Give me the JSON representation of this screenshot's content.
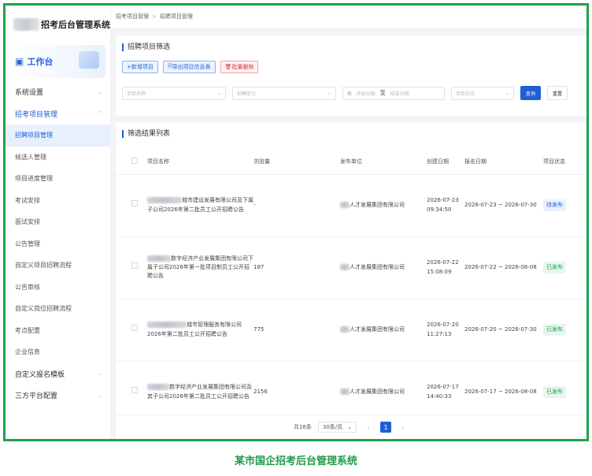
{
  "sidebar": {
    "brand_title": "招考后台管理系统",
    "workbench": "工作台",
    "menu": [
      {
        "label": "系统设置",
        "type": "group",
        "chevron": "⌄"
      },
      {
        "label": "招考项目管理",
        "type": "group-open",
        "chevron": "⌃"
      },
      {
        "label": "招聘项目管理",
        "type": "active"
      },
      {
        "label": "候选人管理",
        "type": "item"
      },
      {
        "label": "项目进度管理",
        "type": "item"
      },
      {
        "label": "考试安排",
        "type": "item"
      },
      {
        "label": "面试安排",
        "type": "item"
      },
      {
        "label": "公告管理",
        "type": "item"
      },
      {
        "label": "自定义项目招聘流程",
        "type": "item"
      },
      {
        "label": "公告审核",
        "type": "item"
      },
      {
        "label": "自定义岗位招聘流程",
        "type": "item"
      },
      {
        "label": "考点配置",
        "type": "item"
      },
      {
        "label": "企业信息",
        "type": "item"
      },
      {
        "label": "自定义报名模板",
        "type": "group",
        "chevron": "⌄"
      },
      {
        "label": "三方平台配置",
        "type": "group",
        "chevron": "⌄"
      }
    ]
  },
  "breadcrumb": {
    "parent": "招考项目管理",
    "sep": ">",
    "current": "招聘项目管理"
  },
  "filter": {
    "title": "招聘项目筛选",
    "add_btn": "+新增项目",
    "export_btn": "导出项目信息表",
    "delete_btn": "批量删除",
    "project_placeholder": "项目名称",
    "unit_placeholder": "招聘单位",
    "start_placeholder": "开始日期",
    "to": "至",
    "end_placeholder": "结束日期",
    "status_placeholder": "项目状态",
    "search_btn": "查询",
    "reset_btn": "重置"
  },
  "list": {
    "title": "筛选结果列表",
    "headers": [
      "项目名称",
      "浏览量",
      "发布单位",
      "创建日期",
      "报名日期",
      "项目状态"
    ],
    "rows": [
      {
        "name_tail": "城市建设发展有限公司及下属子公司2026年第二批员工公开招聘公告",
        "views": "-",
        "unit": "人才发展集团有限公司",
        "created_date": "2026-07-23",
        "created_time": "09:34:50",
        "signup": "2026-07-23 ~ 2026-07-30",
        "status": "待发布",
        "status_type": "pending"
      },
      {
        "name_tail": "数字经济产业发展集团有限公司下属子公司2026年第一批项目制员工公开招聘公告",
        "views": "187",
        "unit": "人才发展集团有限公司",
        "created_date": "2026-07-22",
        "created_time": "15:08:09",
        "signup": "2026-07-22 ~ 2026-08-08",
        "status": "已发布",
        "status_type": "done"
      },
      {
        "name_tail": "城市管理服务有限公司2026年第二批员工公开招聘公告",
        "views": "775",
        "unit": "人才发展集团有限公司",
        "created_date": "2026-07-20",
        "created_time": "11:27:13",
        "signup": "2026-07-20 ~ 2026-07-30",
        "status": "已发布",
        "status_type": "done"
      },
      {
        "name_tail": "数字经济产业发展集团有限公司及其子公司2026年第二批员工公开招聘公告",
        "views": "2156",
        "unit": "人才发展集团有限公司",
        "created_date": "2026-07-17",
        "created_time": "14:40:33",
        "signup": "2026-07-17 ~ 2026-08-08",
        "status": "已发布",
        "status_type": "done"
      }
    ]
  },
  "pager": {
    "total": "共16条",
    "page_size": "30条/页",
    "current": "1",
    "prev": "‹",
    "next": "›"
  },
  "caption": "某市国企招考后台管理系统"
}
